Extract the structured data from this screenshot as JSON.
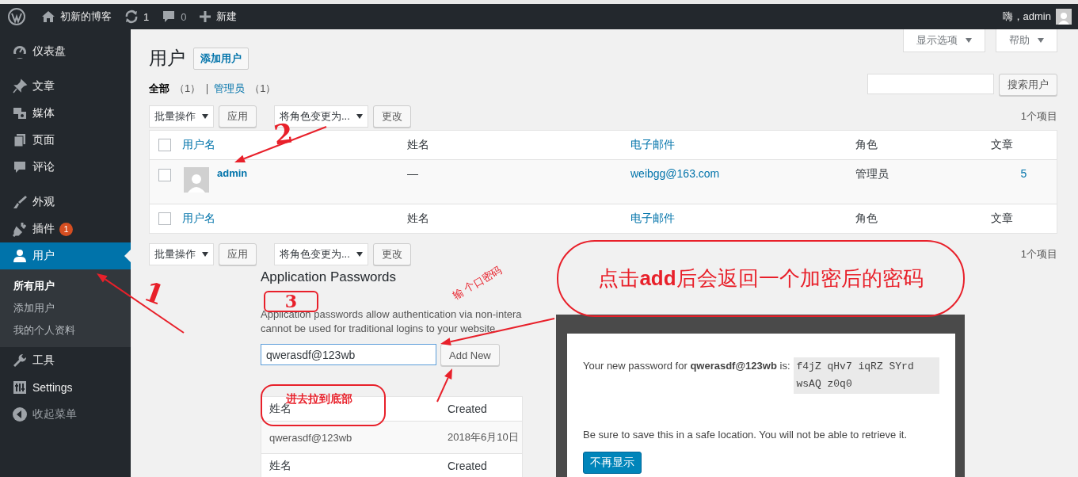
{
  "admin_bar": {
    "site_name": "初新的博客",
    "updates": "1",
    "comments": "0",
    "new_label": "新建",
    "greeting": "嗨，admin"
  },
  "sidebar": {
    "groups": [
      [
        {
          "label": "仪表盘",
          "selected": false
        }
      ],
      [
        {
          "label": "文章",
          "selected": false
        },
        {
          "label": "媒体",
          "selected": false
        },
        {
          "label": "页面",
          "selected": false
        },
        {
          "label": "评论",
          "selected": false
        }
      ],
      [
        {
          "label": "外观",
          "selected": false
        },
        {
          "label": "插件",
          "selected": false,
          "badge": "1"
        },
        {
          "label": "用户",
          "selected": true,
          "submenu": [
            {
              "label": "所有用户",
              "selected": true
            },
            {
              "label": "添加用户",
              "selected": false
            },
            {
              "label": "我的个人资料",
              "selected": false
            }
          ]
        },
        {
          "label": "工具",
          "selected": false
        },
        {
          "label": "Settings",
          "selected": false
        }
      ]
    ],
    "collapse": "收起菜单"
  },
  "screen_meta": {
    "screen_options": "显示选项",
    "help": "帮助"
  },
  "page": {
    "title": "用户",
    "add_button": "添加用户",
    "search_button": "搜索用户",
    "filters": [
      {
        "label": "全部",
        "count": "（1）",
        "selected": true
      },
      {
        "label": "管理员",
        "count": "（1）",
        "selected": false
      }
    ],
    "tablenavs": [
      {
        "bulk": "批量操作",
        "apply": "应用",
        "role": "将角色变更为...",
        "change": "更改",
        "count": "1个项目"
      },
      {
        "bulk": "批量操作",
        "apply": "应用",
        "role": "将角色变更为...",
        "change": "更改",
        "count": "1个项目"
      }
    ],
    "table": {
      "select_all_checked": false,
      "footer_select_all_checked": false,
      "footer_columns": [
        {
          "label": "用户名",
          "link": true
        },
        {
          "label": "姓名",
          "link": false
        },
        {
          "label": "电子邮件",
          "link": true
        },
        {
          "label": "角色",
          "link": false
        },
        {
          "label": "文章",
          "link": false
        }
      ],
      "columns": [
        {
          "label": "用户名",
          "link": true
        },
        {
          "label": "姓名",
          "link": false
        },
        {
          "label": "电子邮件",
          "link": true
        },
        {
          "label": "角色",
          "link": false
        },
        {
          "label": "文章",
          "link": false
        }
      ],
      "rows": [
        {
          "checked": false,
          "username": "admin",
          "name": "—",
          "email": "weibgg@163.com",
          "role": "管理员",
          "posts": "5"
        }
      ]
    }
  },
  "app_passwords": {
    "heading": "Application Passwords",
    "description_lines": [
      "Application passwords allow authentication via non-intera",
      "cannot be used for traditional logins to your website."
    ],
    "field_value": "qwerasdf@123wb",
    "add_button": "Add New",
    "table": {
      "columns": [
        "姓名",
        "Created"
      ],
      "rows": [
        [
          "qwerasdf@123wb",
          "2018年6月10日"
        ]
      ],
      "footer": [
        "姓名",
        "Created"
      ]
    }
  },
  "dialog": {
    "message": "Your new password for **qwerasdf@123wb** is:",
    "password": "f4jZ qHv7 iqRZ SYrd wsAQ z0q0",
    "note": "Be sure to save this in a safe location. You will not be able to retrieve it.",
    "dismiss": "不再显示"
  },
  "annotations": {
    "step_1": "1",
    "step_2": "2",
    "step_3": "3",
    "input_note": "输 个口密码",
    "scroll_note": "进去拉到底部",
    "result_note": "点击**add**后会返回一个加密后的密码"
  }
}
